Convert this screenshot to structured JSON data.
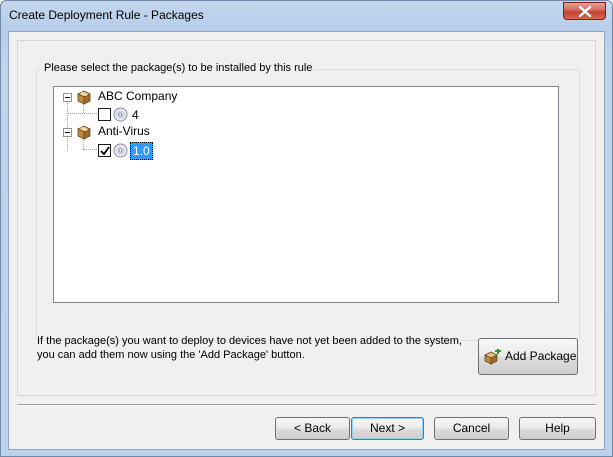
{
  "window": {
    "title": "Create Deployment Rule - Packages"
  },
  "group": {
    "label": "Please select the package(s) to be installed by this rule"
  },
  "tree": [
    {
      "label": "ABC Company",
      "children": [
        {
          "label": "4",
          "checked": false,
          "selected": false
        }
      ]
    },
    {
      "label": "Anti-Virus",
      "children": [
        {
          "label": "1.0",
          "checked": true,
          "selected": true
        }
      ]
    }
  ],
  "info": {
    "line1": "If the package(s) you want to deploy to devices have not yet been added to the system,",
    "line2": "you can add them now using the 'Add Package' button."
  },
  "buttons": {
    "add_package": "Add Package",
    "back": "< Back",
    "next": "Next >",
    "cancel": "Cancel",
    "help": "Help"
  },
  "colors": {
    "selection": "#3399ff",
    "title_bar": "#bcd1ea",
    "close_button": "#c3412f"
  }
}
